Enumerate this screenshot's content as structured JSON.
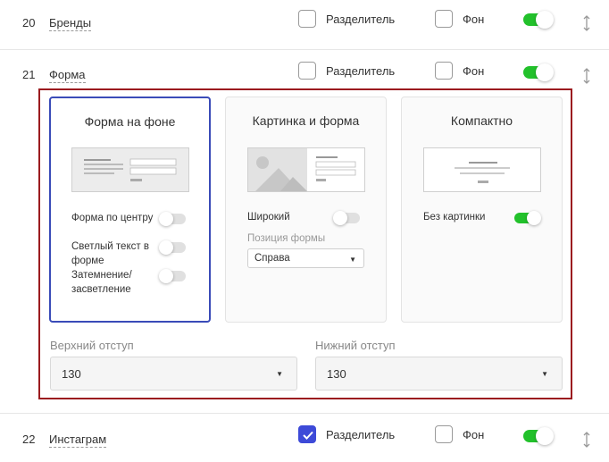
{
  "rows": [
    {
      "num": "20",
      "name": "Бренды",
      "divider": false,
      "background": false,
      "enabled": true
    },
    {
      "num": "21",
      "name": "Форма",
      "divider": false,
      "background": false,
      "enabled": true
    },
    {
      "num": "22",
      "name": "Инстаграм",
      "divider": true,
      "background": false,
      "enabled": true
    }
  ],
  "labels": {
    "divider": "Разделитель",
    "background": "Фон"
  },
  "cards": [
    {
      "title": "Форма на фоне",
      "selected": true,
      "options": [
        {
          "label": "Форма по центру",
          "on": false
        },
        {
          "label": "Светлый текст в форме",
          "on": false
        },
        {
          "label": "Затемнение/засветление",
          "on": false
        }
      ]
    },
    {
      "title": "Картинка и форма",
      "selected": false,
      "options": [
        {
          "label": "Широкий",
          "on": false
        }
      ],
      "position_label": "Позиция формы",
      "position_value": "Справа"
    },
    {
      "title": "Компактно",
      "selected": false,
      "options": [
        {
          "label": "Без картинки",
          "on": true
        }
      ]
    }
  ],
  "padding": {
    "top_label": "Верхний отступ",
    "top_value": "130",
    "bottom_label": "Нижний отступ",
    "bottom_value": "130"
  },
  "colors": {
    "accent": "#3d4ad8",
    "toggle_on": "#22c12b",
    "panel_border": "#9b1b1f"
  }
}
